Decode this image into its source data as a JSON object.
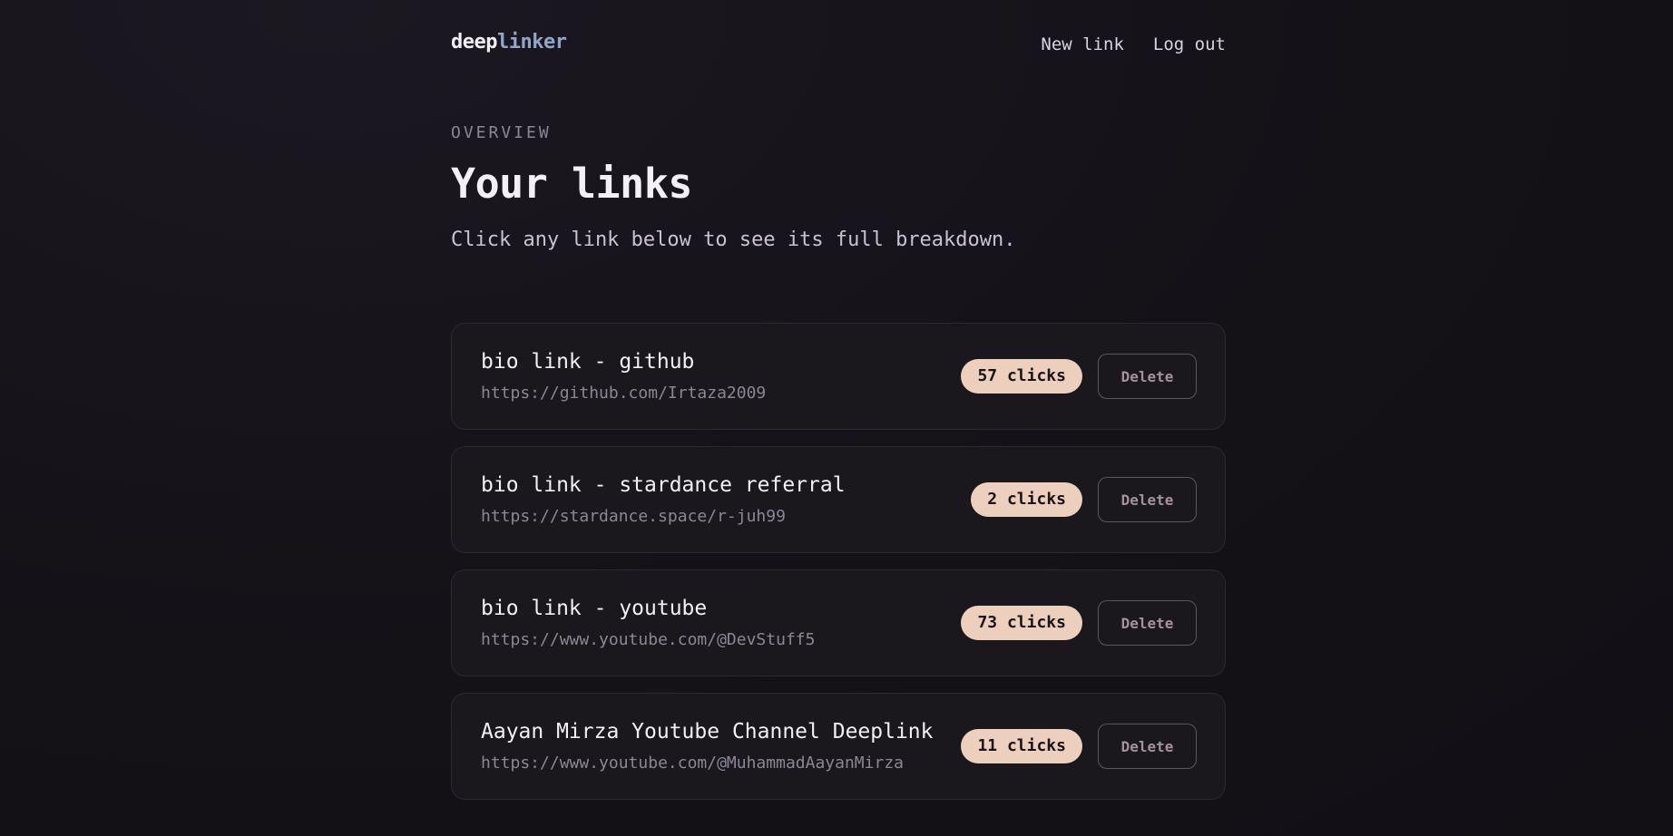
{
  "brand": {
    "part1": "deep",
    "part2": "linker"
  },
  "nav": {
    "new_link": "New link",
    "log_out": "Log out"
  },
  "eyebrow": "OVERVIEW",
  "title": "Your links",
  "subtitle": "Click any link below to see its full breakdown.",
  "links": [
    {
      "name": "bio link - github",
      "url": "https://github.com/Irtaza2009",
      "clicks": "57 clicks",
      "delete_label": "Delete"
    },
    {
      "name": "bio link - stardance referral",
      "url": "https://stardance.space/r-juh99",
      "clicks": "2 clicks",
      "delete_label": "Delete"
    },
    {
      "name": "bio link - youtube",
      "url": "https://www.youtube.com/@DevStuff5",
      "clicks": "73 clicks",
      "delete_label": "Delete"
    },
    {
      "name": "Aayan Mirza Youtube Channel Deeplink",
      "url": "https://www.youtube.com/@MuhammadAayanMirza",
      "clicks": "11 clicks",
      "delete_label": "Delete"
    }
  ],
  "colors": {
    "background": "#141117",
    "card": "#1a171d",
    "badge": "#ecd0bd",
    "brand_accent": "#8fa6c6"
  }
}
